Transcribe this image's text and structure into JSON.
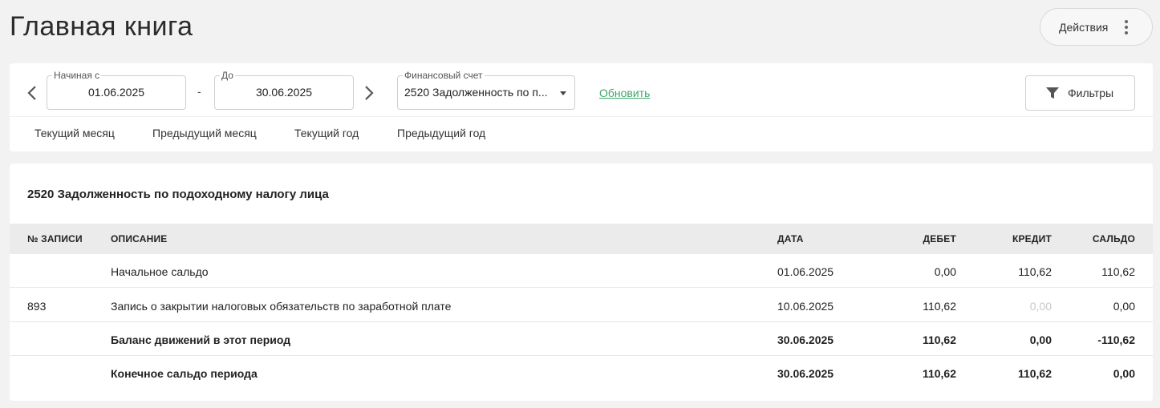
{
  "page": {
    "title": "Главная книга"
  },
  "actions": {
    "label": "Действия"
  },
  "filters": {
    "date_from": {
      "label": "Начиная с",
      "value": "01.06.2025"
    },
    "separator": "-",
    "date_to": {
      "label": "До",
      "value": "30.06.2025"
    },
    "account": {
      "label": "Финансовый счет",
      "value": "2520 Задолженность по п..."
    },
    "refresh_label": "Обновить",
    "filters_button": "Фильтры",
    "quick_ranges": [
      "Текущий месяц",
      "Предыдущий месяц",
      "Текущий год",
      "Предыдущий год"
    ]
  },
  "ledger": {
    "title": "2520 Задолженность по подоходному налогу лица",
    "columns": {
      "entry_no": "№ ЗАПИСИ",
      "description": "ОПИСАНИЕ",
      "date": "ДАТА",
      "debit": "ДЕБЕТ",
      "credit": "КРЕДИТ",
      "balance": "САЛЬДО"
    },
    "rows": [
      {
        "entry_no": "",
        "description": "Начальное сальдо",
        "date": "01.06.2025",
        "debit": "0,00",
        "credit": "110,62",
        "balance": "110,62"
      },
      {
        "entry_no": "893",
        "description": "Запись о закрытии налоговых обязательств по заработной плате",
        "date": "10.06.2025",
        "debit": "110,62",
        "credit": "0,00",
        "balance": "0,00"
      },
      {
        "entry_no": "",
        "description": "Баланс движений в этот период",
        "date": "30.06.2025",
        "debit": "110,62",
        "credit": "0,00",
        "balance": "-110,62"
      },
      {
        "entry_no": "",
        "description": "Конечное сальдо периода",
        "date": "30.06.2025",
        "debit": "110,62",
        "credit": "110,62",
        "balance": "0,00"
      }
    ]
  },
  "colors": {
    "accent_link": "#3ea56a",
    "header_bg": "#ebebeb"
  },
  "icons": {
    "prev": "chevron-left-icon",
    "next": "chevron-right-icon",
    "menu": "more-vertical-icon",
    "filter": "filter-icon",
    "dropdown": "caret-down-icon"
  }
}
